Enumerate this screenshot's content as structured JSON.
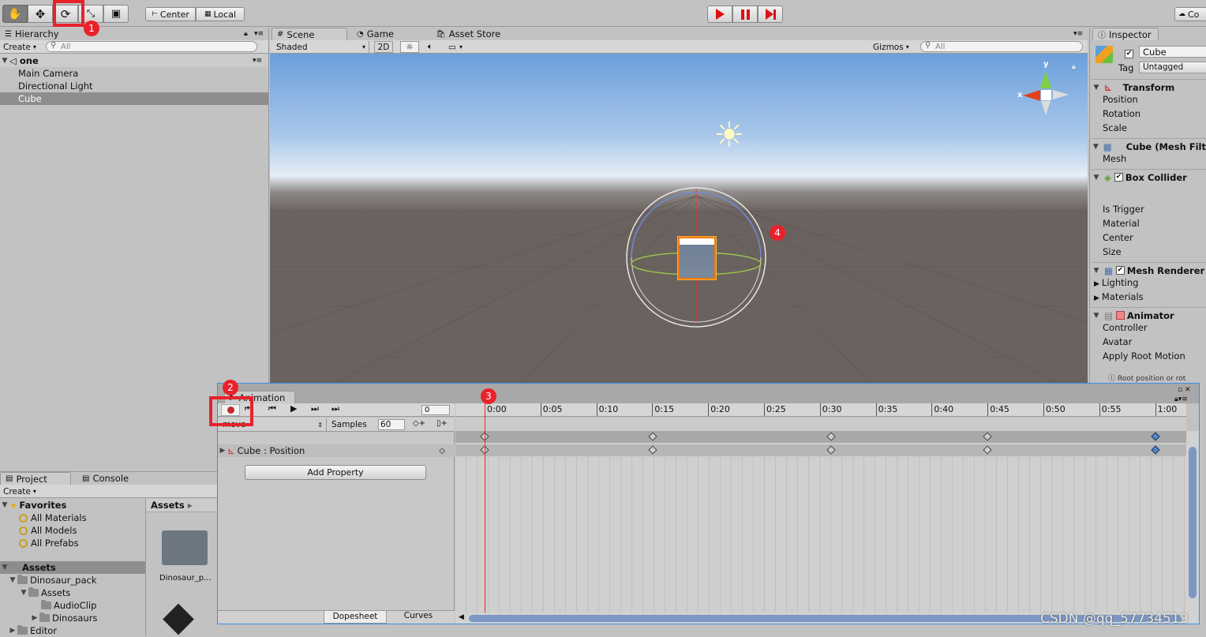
{
  "toolbar": {
    "pivot_label": "Center",
    "space_label": "Local",
    "collab_label": "Co"
  },
  "hierarchy": {
    "tab": "Hierarchy",
    "create": "Create",
    "search_placeholder": "All",
    "scene_name": "one",
    "items": [
      "Main Camera",
      "Directional Light",
      "Cube"
    ],
    "selected": "Cube"
  },
  "scene": {
    "tabs": [
      "Scene",
      "Game",
      "Asset Store"
    ],
    "shading": "Shaded",
    "mode_2d": "2D",
    "gizmos": "Gizmos",
    "search_placeholder": "All",
    "axis_y": "y",
    "axis_x": "x"
  },
  "inspector": {
    "tab": "Inspector",
    "object_name": "Cube",
    "tag_label": "Tag",
    "tag_value": "Untagged",
    "transform": {
      "title": "Transform",
      "fields": [
        "Position",
        "Rotation",
        "Scale"
      ]
    },
    "mesh_filter": {
      "title": "Cube (Mesh Filt",
      "fields": [
        "Mesh"
      ]
    },
    "box_collider": {
      "title": "Box Collider",
      "fields": [
        "Is Trigger",
        "Material",
        "Center",
        "Size"
      ]
    },
    "mesh_renderer": {
      "title": "Mesh Renderer",
      "fields": [
        "Lighting",
        "Materials"
      ]
    },
    "animator": {
      "title": "Animator",
      "fields": [
        "Controller",
        "Avatar",
        "Apply Root Motion"
      ],
      "cut_text": "Root position or rot"
    }
  },
  "project": {
    "tabs": [
      "Project",
      "Console"
    ],
    "create": "Create",
    "favorites_label": "Favorites",
    "favorites": [
      "All Materials",
      "All Models",
      "All Prefabs"
    ],
    "assets_label": "Assets",
    "tree": [
      "Dinosaur_pack",
      "Assets",
      "AudioClip",
      "Dinosaurs",
      "Editor"
    ],
    "breadcrumb": "Assets",
    "grid_item": "Dinosaur_p..."
  },
  "animation": {
    "tab": "Animation",
    "frame": "0",
    "clip": "move",
    "samples_label": "Samples",
    "samples": "60",
    "property": "Cube : Position",
    "add_property": "Add Property",
    "bottom_tabs": [
      "Dopesheet",
      "Curves"
    ],
    "timeline": [
      "0:00",
      "0:05",
      "0:10",
      "0:15",
      "0:20",
      "0:25",
      "0:30",
      "0:35",
      "0:40",
      "0:45",
      "0:50",
      "0:55",
      "1:00"
    ]
  },
  "annotations": {
    "labels": [
      "1",
      "2",
      "3",
      "4"
    ],
    "color": "#e8222a"
  },
  "watermark": "CSDN @qq_57734519",
  "colors": {
    "selection": "#8e8e8e",
    "sky_top": "#6b9fdb",
    "ground": "#6a625e",
    "record_red": "#c62828",
    "keyframe_blue": "#4f86d6",
    "playhead": "#e22"
  }
}
